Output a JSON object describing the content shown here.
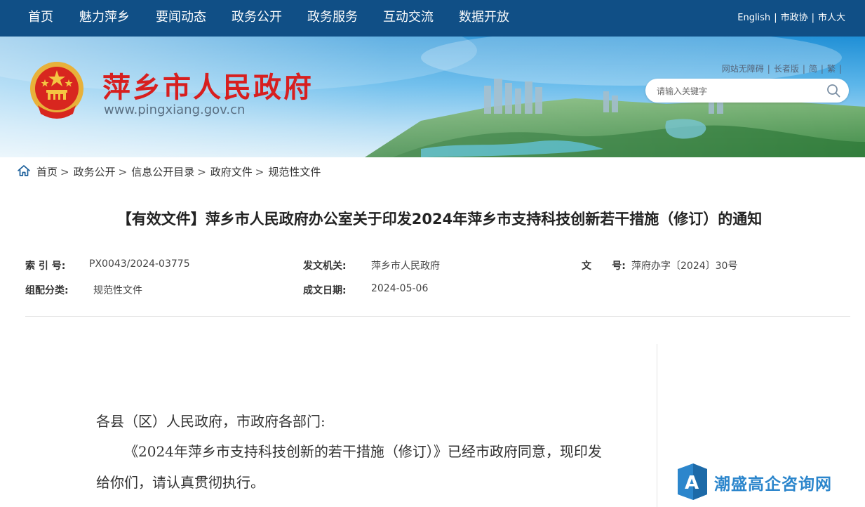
{
  "topnav": {
    "items": [
      "首页",
      "魅力萍乡",
      "要闻动态",
      "政务公开",
      "政务服务",
      "互动交流",
      "数据开放"
    ],
    "right_links": [
      "English",
      "市政协",
      "市人大"
    ]
  },
  "header": {
    "site_name": "萍乡市人民政府",
    "site_url": "www.pingxiang.gov.cn",
    "util_links": [
      "网站无障碍",
      "长者版",
      "简",
      "繁"
    ],
    "search_placeholder": "请输入关键字"
  },
  "breadcrumb": [
    "首页",
    "政务公开",
    "信息公开目录",
    "政府文件",
    "规范性文件"
  ],
  "document": {
    "title": "【有效文件】萍乡市人民政府办公室关于印发2024年萍乡市支持科技创新若干措施（修订）的通知",
    "meta": {
      "index_no_label": "索 引 号:",
      "index_no": "PX0043/2024-03775",
      "issuer_label": "发文机关:",
      "issuer": "萍乡市人民政府",
      "doc_no_label": "文      号:",
      "doc_no": "萍府办字〔2024〕30号",
      "category_label": "组配分类:",
      "category": "规范性文件",
      "date_label": "成文日期:",
      "date": "2024-05-06"
    },
    "salutation": "各县（区）人民政府，市政府各部门:",
    "paragraph_line1": "《2024年萍乡市支持科技创新的若干措施（修订）》已经市政府同意，现印发",
    "paragraph_line2": "给你们，请认真贯彻执行。"
  },
  "watermark": {
    "letter": "A",
    "text": "潮盛高企咨询网"
  },
  "colors": {
    "nav_bg": "#104f86",
    "site_name": "#d71f1f",
    "watermark": "#2c86cc"
  }
}
